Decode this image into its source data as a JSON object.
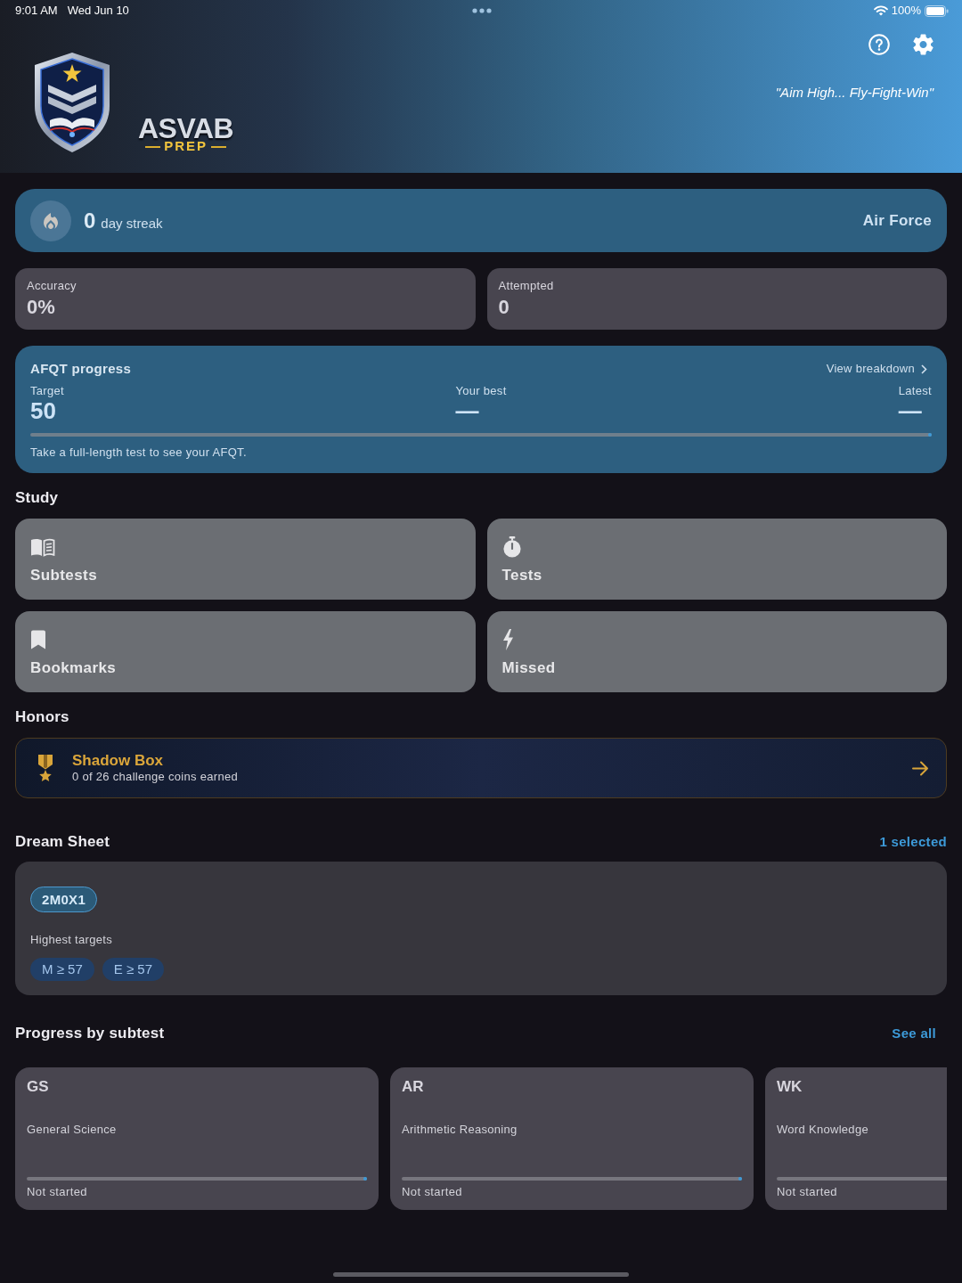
{
  "status_bar": {
    "time": "9:01 AM",
    "date": "Wed Jun 10",
    "battery": "100%"
  },
  "header": {
    "logo_title": "ASVAB",
    "logo_subtitle": "PREP",
    "motto": "\"Aim High... Fly-Fight-Win\""
  },
  "streak": {
    "count": "0",
    "label": "day streak",
    "branch": "Air Force"
  },
  "stats": [
    {
      "label": "Accuracy",
      "value": "0%"
    },
    {
      "label": "Attempted",
      "value": "0"
    }
  ],
  "afqt": {
    "title": "AFQT progress",
    "link": "View breakdown",
    "metrics": [
      {
        "label": "Target",
        "value": "50"
      },
      {
        "label": "Your best",
        "value": "—"
      },
      {
        "label": "Latest",
        "value": "—"
      }
    ],
    "level": 0,
    "hint": "Take a full-length test to see your AFQT."
  },
  "study": {
    "heading": "Study",
    "items": [
      {
        "label": "Subtests"
      },
      {
        "label": "Tests"
      },
      {
        "label": "Bookmarks"
      },
      {
        "label": "Missed"
      }
    ]
  },
  "honors": {
    "heading": "Honors",
    "title": "Shadow Box",
    "subtitle": "0 of 26 challenge coins earned"
  },
  "dream_sheet": {
    "heading": "Dream Sheet",
    "selection": "1 selected",
    "jobs": [
      {
        "code": "2M0X1",
        "selected": true
      }
    ],
    "targets_label": "Highest targets",
    "targets": [
      "M ≥ 57",
      "E ≥ 57"
    ]
  },
  "subtest_progress": {
    "heading": "Progress by subtest",
    "link": "See all",
    "items": [
      {
        "code": "GS",
        "name": "General Science",
        "status": "Not started",
        "level": 0
      },
      {
        "code": "AR",
        "name": "Arithmetic Reasoning",
        "status": "Not started",
        "level": 0
      },
      {
        "code": "WK",
        "name": "Word Knowledge",
        "status": "Not started",
        "level": 0
      }
    ]
  }
}
